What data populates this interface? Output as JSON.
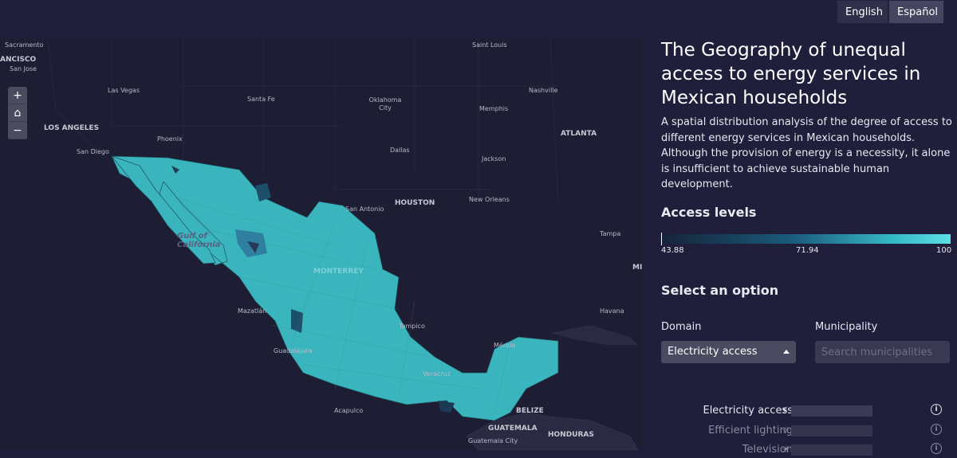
{
  "lang": {
    "english": "English",
    "spanish": "Español"
  },
  "map": {
    "zoom_in": "+",
    "home": "⌂",
    "zoom_out": "−",
    "cities": {
      "sacramento": "Sacramento",
      "francisco": "ANCISCO",
      "san_jose": "San Jose",
      "las_vegas": "Las Vegas",
      "santa_fe": "Santa Fe",
      "oklahoma": "Oklahoma City",
      "memphis": "Memphis",
      "nashville": "Nashville",
      "saint_louis": "Saint Louis",
      "los_angeles": "LOS ANGELES",
      "phoenix": "Phoenix",
      "atlanta": "ATLANTA",
      "san_diego": "San Diego",
      "dallas": "Dallas",
      "jackson": "Jackson",
      "houston": "HOUSTON",
      "san_antonio": "San Antonio",
      "new_orleans": "New Orleans",
      "tampa": "Tampa",
      "monterrey": "MONTERREY",
      "mazatlan": "Mazatlán",
      "havana": "Havana",
      "tampico": "Tampico",
      "guadalajara": "Guadalajara",
      "merida": "Mérida",
      "veracruz": "Veracruz",
      "acapulco": "Acapulco",
      "belize": "BELIZE",
      "guatemala": "GUATEMALA",
      "honduras": "HONDURAS",
      "guatemala_city": "Guatemala City",
      "mi": "MI"
    },
    "gulf": "Gulf of California"
  },
  "panel": {
    "title": "The Geography of unequal access to energy services in Mexican households",
    "description": "A spatial distribution analysis of the degree of access to different energy services in Mexican households. Although the provision of energy is a necessity, it alone is insufficient to achieve sustainable human development.",
    "access_heading": "Access levels",
    "legend": {
      "min": "43.88",
      "mid": "71.94",
      "max": "100"
    },
    "select_heading": "Select an option",
    "domain_label": "Domain",
    "domain_value": "Electricity access",
    "municipality_label": "Municipality",
    "municipality_placeholder": "Search municipalities",
    "rows": [
      {
        "label": "Electricity access",
        "icon": "⚡"
      },
      {
        "label": "Efficient lighting",
        "icon": "☼"
      },
      {
        "label": "Television",
        "icon": "☀"
      }
    ]
  },
  "colors": {
    "background": "#1f1f3b",
    "map_fill": "#3bb5bd",
    "accent": "#5de0e4"
  }
}
